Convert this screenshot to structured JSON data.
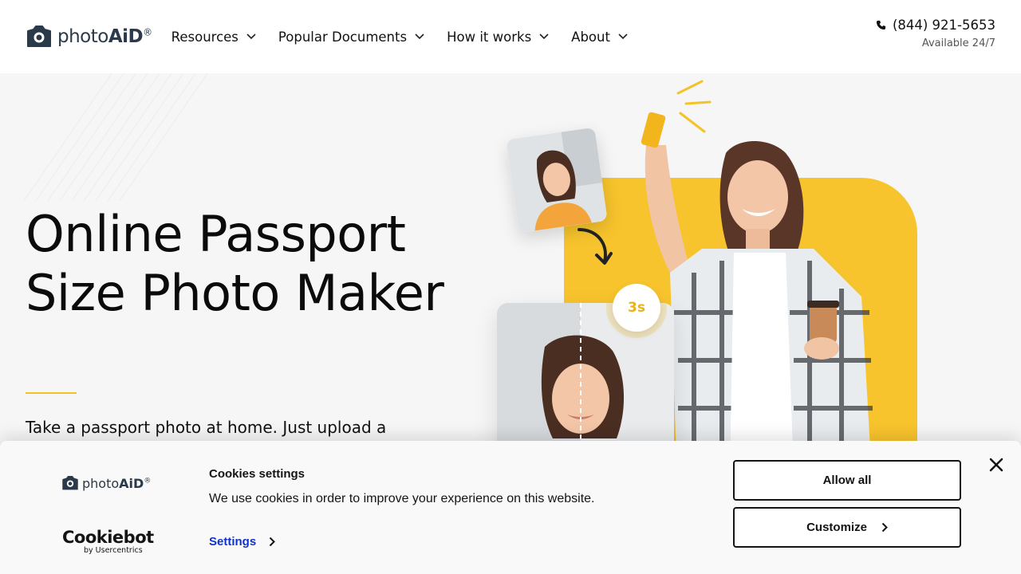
{
  "header": {
    "logo": {
      "text_light": "photo",
      "text_bold": "AiD",
      "reg": "®"
    },
    "nav": [
      {
        "label": "Resources"
      },
      {
        "label": "Popular Documents"
      },
      {
        "label": "How it works"
      },
      {
        "label": "About"
      }
    ],
    "phone": "(844) 921-5653",
    "availability": "Available 24/7"
  },
  "hero": {
    "title": "Online Passport Size Photo Maker",
    "subtitle": "Take a passport photo at home. Just upload a",
    "badge": "3s"
  },
  "cookie_banner": {
    "logo": {
      "text_light": "photo",
      "text_bold": "AiD",
      "reg": "®"
    },
    "powered_by_name": "Cookiebot",
    "powered_by_sub": "by Usercentrics",
    "title": "Cookies settings",
    "text": "We use cookies in order to improve your experience on this website.",
    "settings_label": "Settings",
    "allow_all_label": "Allow all",
    "customize_label": "Customize"
  },
  "colors": {
    "accent_yellow": "#f8c42d",
    "brand_dark": "#2b3a4a",
    "link_blue": "#1032cf"
  }
}
